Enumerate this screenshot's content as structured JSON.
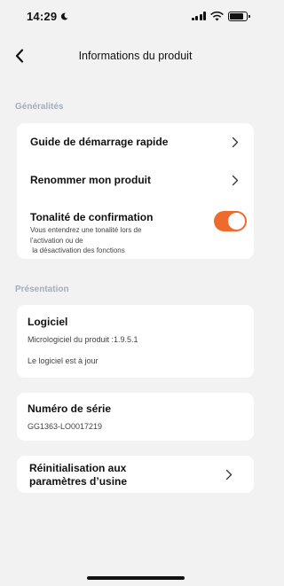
{
  "status_bar": {
    "time": "14:29",
    "battery_level": 0.85
  },
  "nav": {
    "title": "Informations du produit"
  },
  "sections": {
    "general": {
      "title": "Généralités",
      "quick_start": "Guide de démarrage rapide",
      "rename": "Renommer mon produit",
      "confirmation_tone": {
        "label": "Tonalité de confirmation",
        "description_line1": "Vous entendrez une tonalité lors de",
        "description_line2": "l’activation ou de",
        "description_line3": " la désactivation des fonctions",
        "enabled": true
      }
    },
    "presentation": {
      "title": "Présentation",
      "software": {
        "title": "Logiciel",
        "firmware": "Micrologiciel du produit :1.9.5.1",
        "status": "Le logiciel est à jour"
      },
      "serial": {
        "title": "Numéro de série",
        "value": "GG1363-LO0017219"
      },
      "factory_reset": {
        "line1": "Réinitialisation aux",
        "line2": "paramètres d’usine"
      }
    }
  },
  "colors": {
    "accent": "#ee6a2d",
    "background": "#f2f2f2",
    "section_title": "#a6acbd"
  }
}
